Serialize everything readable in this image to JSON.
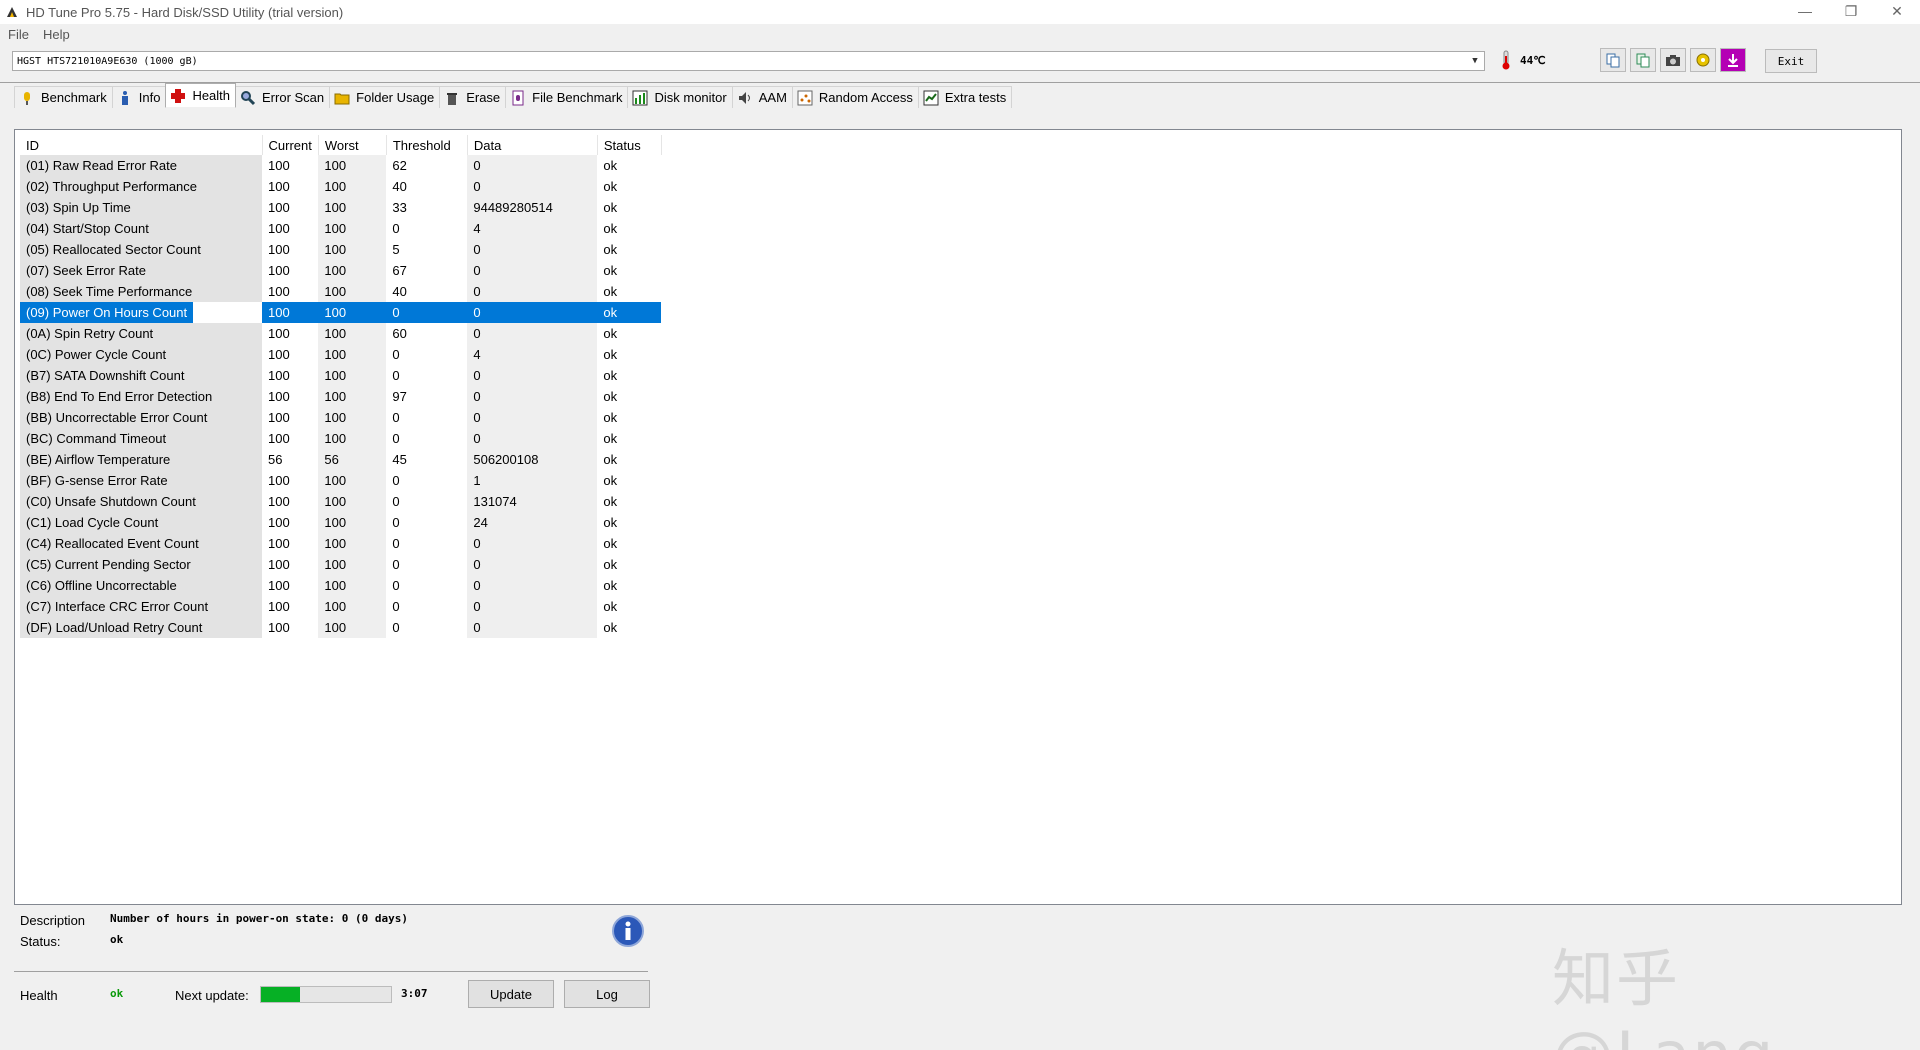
{
  "window": {
    "title": "HD Tune Pro 5.75 - Hard Disk/SSD Utility (trial version)",
    "minimize": "—",
    "restore": "❐",
    "close": "✕"
  },
  "menu": [
    "File",
    "Help"
  ],
  "drive": {
    "selected": "HGST HTS721010A9E630 (1000 gB)",
    "temperature": "44℃"
  },
  "toolbar": {
    "exit_label": "Exit"
  },
  "tabs": [
    {
      "label": "Benchmark",
      "icon": "benchmark-icon"
    },
    {
      "label": "Info",
      "icon": "info-icon"
    },
    {
      "label": "Health",
      "icon": "health-cross-icon",
      "active": true
    },
    {
      "label": "Error Scan",
      "icon": "magnifier-icon"
    },
    {
      "label": "Folder Usage",
      "icon": "folder-icon"
    },
    {
      "label": "Erase",
      "icon": "trash-icon"
    },
    {
      "label": "File Benchmark",
      "icon": "file-benchmark-icon"
    },
    {
      "label": "Disk monitor",
      "icon": "chart-icon"
    },
    {
      "label": "AAM",
      "icon": "speaker-icon"
    },
    {
      "label": "Random Access",
      "icon": "random-access-icon"
    },
    {
      "label": "Extra tests",
      "icon": "extra-tests-icon"
    }
  ],
  "table": {
    "headers": [
      "ID",
      "Current",
      "Worst",
      "Threshold",
      "Data",
      "Status"
    ],
    "selected_index": 7,
    "rows": [
      [
        "(01) Raw Read Error Rate",
        "100",
        "100",
        "62",
        "0",
        "ok"
      ],
      [
        "(02) Throughput Performance",
        "100",
        "100",
        "40",
        "0",
        "ok"
      ],
      [
        "(03) Spin Up Time",
        "100",
        "100",
        "33",
        "94489280514",
        "ok"
      ],
      [
        "(04) Start/Stop Count",
        "100",
        "100",
        "0",
        "4",
        "ok"
      ],
      [
        "(05) Reallocated Sector Count",
        "100",
        "100",
        "5",
        "0",
        "ok"
      ],
      [
        "(07) Seek Error Rate",
        "100",
        "100",
        "67",
        "0",
        "ok"
      ],
      [
        "(08) Seek Time Performance",
        "100",
        "100",
        "40",
        "0",
        "ok"
      ],
      [
        "(09) Power On Hours Count",
        "100",
        "100",
        "0",
        "0",
        "ok"
      ],
      [
        "(0A) Spin Retry Count",
        "100",
        "100",
        "60",
        "0",
        "ok"
      ],
      [
        "(0C) Power Cycle Count",
        "100",
        "100",
        "0",
        "4",
        "ok"
      ],
      [
        "(B7) SATA Downshift Count",
        "100",
        "100",
        "0",
        "0",
        "ok"
      ],
      [
        "(B8) End To End Error Detection",
        "100",
        "100",
        "97",
        "0",
        "ok"
      ],
      [
        "(BB) Uncorrectable Error Count",
        "100",
        "100",
        "0",
        "0",
        "ok"
      ],
      [
        "(BC) Command Timeout",
        "100",
        "100",
        "0",
        "0",
        "ok"
      ],
      [
        "(BE) Airflow Temperature",
        "56",
        "56",
        "45",
        "506200108",
        "ok"
      ],
      [
        "(BF) G-sense Error Rate",
        "100",
        "100",
        "0",
        "1",
        "ok"
      ],
      [
        "(C0) Unsafe Shutdown Count",
        "100",
        "100",
        "0",
        "131074",
        "ok"
      ],
      [
        "(C1) Load Cycle Count",
        "100",
        "100",
        "0",
        "24",
        "ok"
      ],
      [
        "(C4) Reallocated Event Count",
        "100",
        "100",
        "0",
        "0",
        "ok"
      ],
      [
        "(C5) Current Pending Sector",
        "100",
        "100",
        "0",
        "0",
        "ok"
      ],
      [
        "(C6) Offline Uncorrectable",
        "100",
        "100",
        "0",
        "0",
        "ok"
      ],
      [
        "(C7) Interface CRC Error Count",
        "100",
        "100",
        "0",
        "0",
        "ok"
      ],
      [
        "(DF) Load/Unload Retry Count",
        "100",
        "100",
        "0",
        "0",
        "ok"
      ]
    ]
  },
  "details": {
    "description_label": "Description",
    "description_value": "Number of hours in power-on state: 0 (0 days)",
    "status_label": "Status:",
    "status_value": "ok"
  },
  "footer": {
    "health_label": "Health",
    "health_value": "ok",
    "next_update_label": "Next update:",
    "next_update_progress": 0.3,
    "next_update_time": "3:07",
    "update_label": "Update",
    "log_label": "Log"
  },
  "watermark": "知乎 @Lang",
  "colors": {
    "selection": "#0078d7",
    "progress": "#06b025",
    "health_ok": "#0a9a0a"
  }
}
